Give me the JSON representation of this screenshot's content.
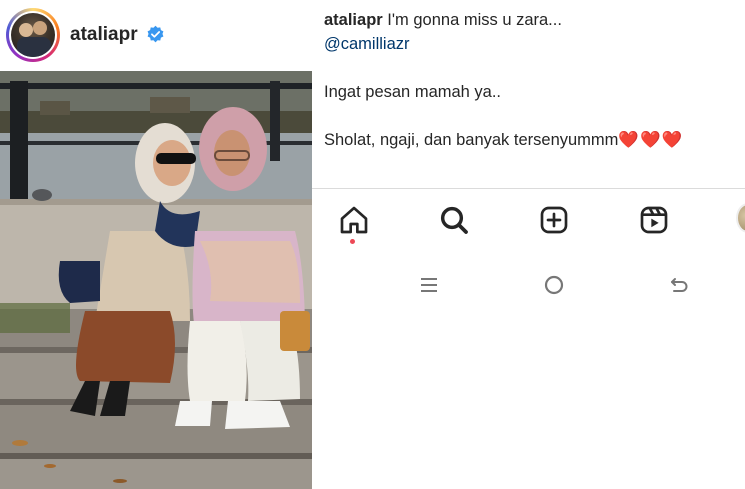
{
  "post": {
    "username": "ataliapr",
    "verified": true,
    "avatar_icon": "profile-avatar"
  },
  "caption": {
    "username": "ataliapr",
    "line1_text": "I'm gonna miss u zara...",
    "mention": "@camilliazr",
    "line2": "Ingat pesan mamah ya..",
    "line3": "Sholat, ngaji, dan banyak tersenyummm",
    "hearts": "❤️❤️❤️"
  },
  "bottom_nav": {
    "items": [
      {
        "name": "home",
        "icon": "home-icon",
        "active": true
      },
      {
        "name": "search",
        "icon": "search-icon"
      },
      {
        "name": "create",
        "icon": "plus-square-icon"
      },
      {
        "name": "reels",
        "icon": "reels-icon"
      },
      {
        "name": "profile",
        "icon": "profile-avatar-icon"
      }
    ],
    "notification_color": "#ed4956"
  },
  "system_nav": {
    "items": [
      {
        "name": "recents",
        "icon": "menu-lines-icon"
      },
      {
        "name": "home",
        "icon": "circle-icon"
      },
      {
        "name": "back",
        "icon": "back-arrow-icon"
      }
    ]
  },
  "colors": {
    "text": "#262626",
    "mention": "#00376b",
    "verified": "#3897f0",
    "divider": "#dbdbdb"
  }
}
